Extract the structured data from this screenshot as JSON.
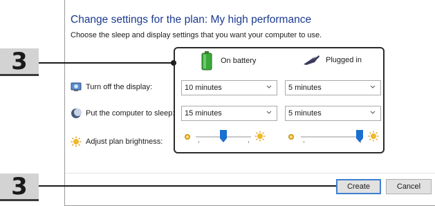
{
  "header": {
    "title": "Change settings for the plan: My high performance",
    "subtitle": "Choose the sleep and display settings that you want your computer to use."
  },
  "callouts": {
    "top": "3",
    "bottom": "3"
  },
  "columns": {
    "battery": "On battery",
    "plugged": "Plugged in"
  },
  "rows": {
    "display": {
      "label": "Turn off the display:",
      "battery_value": "10 minutes",
      "plugged_value": "5 minutes"
    },
    "sleep": {
      "label": "Put the computer to sleep:",
      "battery_value": "15 minutes",
      "plugged_value": "5 minutes"
    },
    "brightness": {
      "label": "Adjust plan brightness:",
      "battery_level": 0.5,
      "plugged_level": 1.0
    }
  },
  "buttons": {
    "create": "Create",
    "cancel": "Cancel"
  },
  "colors": {
    "title": "#1a3a8f",
    "slider_thumb": "#1a6fd1",
    "panel_border": "#2a2a2a"
  },
  "icons": {
    "battery": "battery-icon",
    "plug": "plug-icon",
    "display": "display-icon",
    "sleep": "moon-icon",
    "brightness": "sun-icon"
  }
}
